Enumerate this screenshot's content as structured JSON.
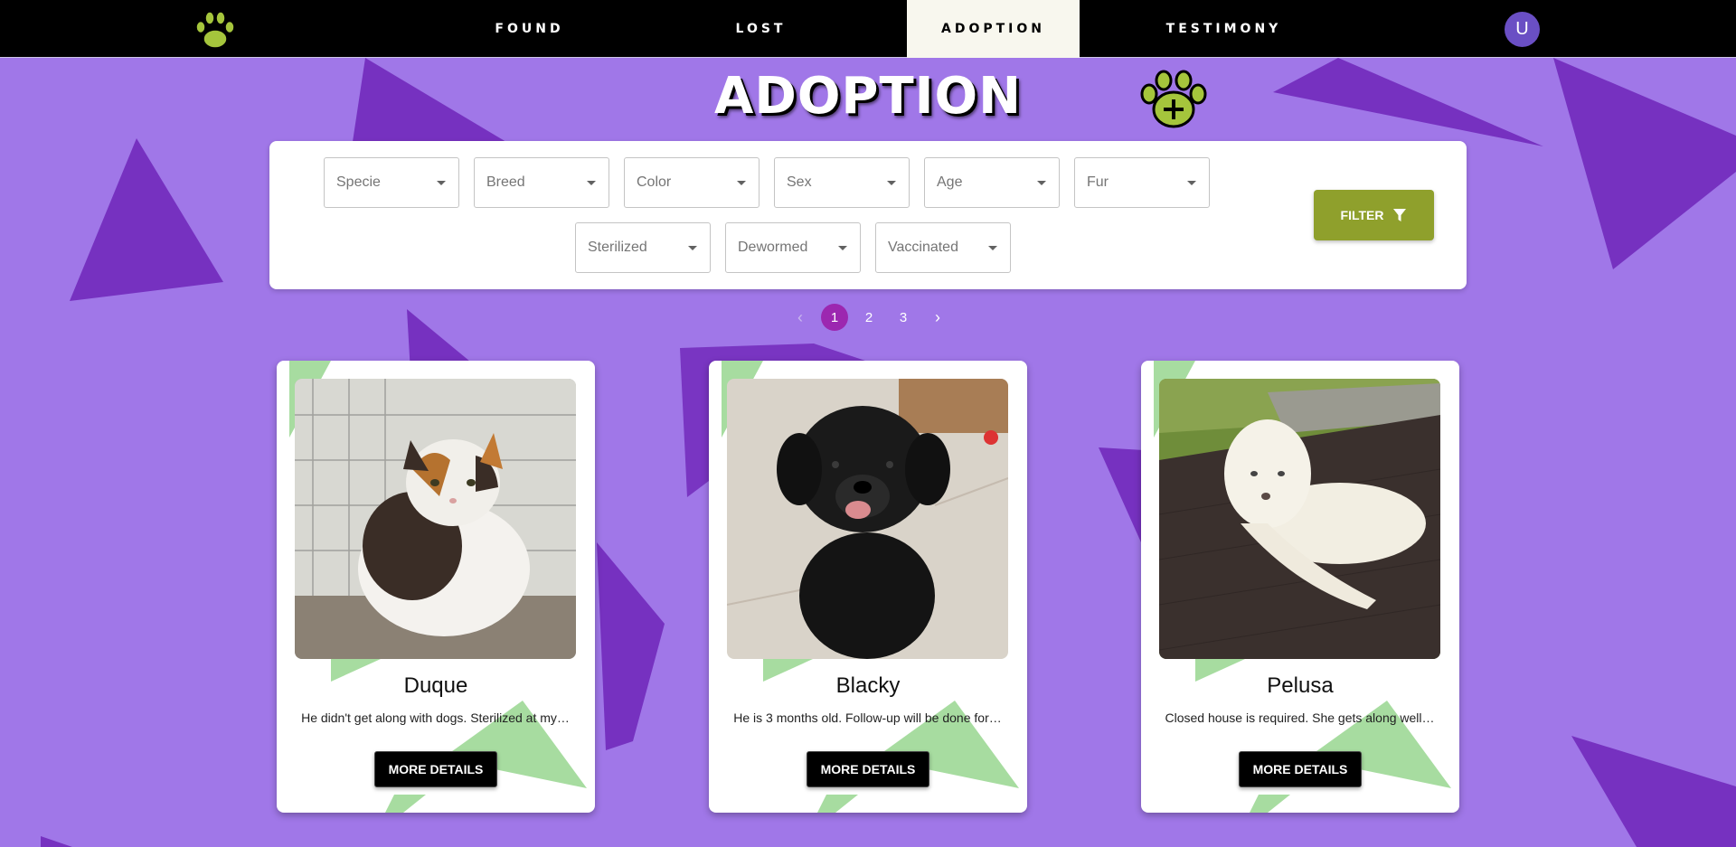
{
  "nav": {
    "items": [
      {
        "label": "FOUND",
        "active": false
      },
      {
        "label": "LOST",
        "active": false
      },
      {
        "label": "ADOPTION",
        "active": true
      },
      {
        "label": "TESTIMONY",
        "active": false
      }
    ],
    "avatar_initial": "U",
    "logo_icon": "paw-icon"
  },
  "page": {
    "title": "ADOPTION",
    "add_icon": "paw-plus-icon"
  },
  "filters": {
    "row1": [
      "Specie",
      "Breed",
      "Color",
      "Sex",
      "Age",
      "Fur"
    ],
    "row2": [
      "Sterilized",
      "Dewormed",
      "Vaccinated"
    ],
    "button_label": "FILTER",
    "button_icon": "filter-icon"
  },
  "pagination": {
    "pages": [
      "1",
      "2",
      "3"
    ],
    "current": "1",
    "prev_icon": "chevron-left-icon",
    "next_icon": "chevron-right-icon"
  },
  "cards": [
    {
      "name": "Duque",
      "description": "He didn't get along with dogs. Sterilized at my…",
      "button": "MORE DETAILS"
    },
    {
      "name": "Blacky",
      "description": "He is 3 months old. Follow-up will be done for…",
      "button": "MORE DETAILS"
    },
    {
      "name": "Pelusa",
      "description": "Closed house is required. She gets along well…",
      "button": "MORE DETAILS"
    }
  ],
  "colors": {
    "background": "#a077e8",
    "shapes": "#6f24b8",
    "accent_green": "#8fa02c",
    "paw_green": "#a5c53c",
    "pagination_current": "#9c27b0"
  }
}
